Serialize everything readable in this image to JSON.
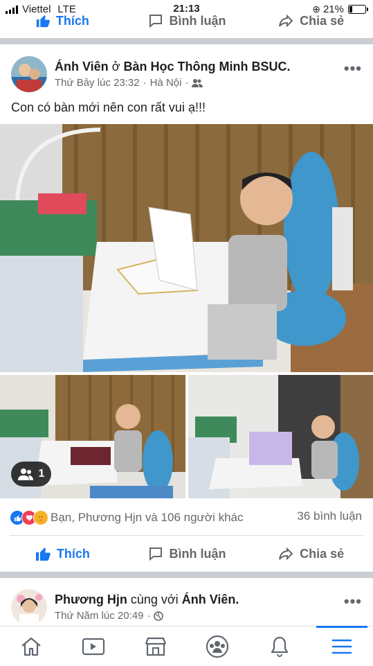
{
  "status_bar": {
    "carrier": "Viettel",
    "network": "LTE",
    "time": "21:13",
    "battery": "21%"
  },
  "actions": {
    "like": "Thích",
    "comment": "Bình luận",
    "share": "Chia sẻ"
  },
  "post": {
    "author": "Ánh Viên",
    "connector": "ở",
    "place": "Bàn Học Thông Minh BSUC.",
    "timestamp": "Thứ Bảy lúc 23:32",
    "location": "Hà Nội",
    "privacy_icon": "friends-icon",
    "text": "Con có bàn mới nên con rất vui ạ!!!",
    "more_photos_count": "1",
    "reactions_text": "Bạn, Phương Hjn và 106 người khác",
    "comments_count": "36 bình luận",
    "reaction_icons": [
      "like-icon",
      "love-icon",
      "care-icon"
    ]
  },
  "next_post": {
    "author": "Phương Hjn",
    "connector": "cùng với",
    "tagged": "Ánh Viên.",
    "timestamp": "Thứ Năm lúc 20:49",
    "privacy_icon": "public-icon"
  },
  "bottom_nav": [
    "home-icon",
    "watch-icon",
    "marketplace-icon",
    "groups-icon",
    "notifications-icon",
    "menu-icon"
  ],
  "colors": {
    "brand_blue": "#1877f2",
    "muted": "#65676b",
    "separator": "#c9ccd1"
  }
}
